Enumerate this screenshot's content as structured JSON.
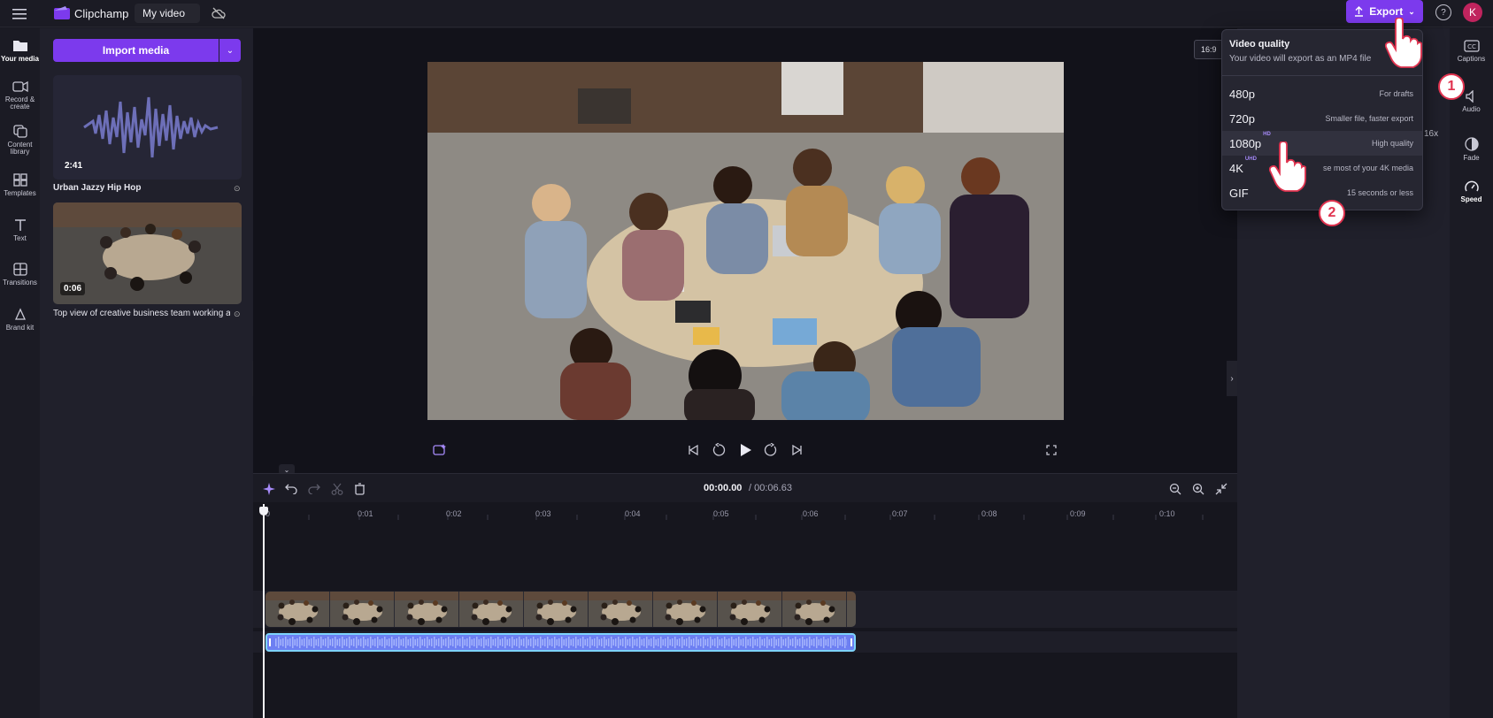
{
  "app": {
    "name": "Clipchamp",
    "project_title": "My video",
    "avatar_initial": "K"
  },
  "topbar": {
    "export_label": "Export"
  },
  "left_rail": [
    {
      "label": "Your media",
      "icon": "folder-icon"
    },
    {
      "label": "Record & create",
      "icon": "camera-icon"
    },
    {
      "label": "Content library",
      "icon": "library-icon"
    },
    {
      "label": "Templates",
      "icon": "templates-icon"
    },
    {
      "label": "Text",
      "icon": "text-icon"
    },
    {
      "label": "Transitions",
      "icon": "transitions-icon"
    },
    {
      "label": "Brand kit",
      "icon": "brand-kit-icon"
    }
  ],
  "media_panel": {
    "import_label": "Import media",
    "items": [
      {
        "title": "Urban Jazzy Hip Hop",
        "duration": "2:41"
      },
      {
        "title": "Top view of creative business team working at ...",
        "duration": "0:06"
      }
    ]
  },
  "stage": {
    "aspect_ratio": "16:9",
    "speed_partial": "16x"
  },
  "right_rail": [
    {
      "label": "Captions",
      "icon": "captions-icon"
    },
    {
      "label": "Audio",
      "icon": "audio-icon"
    },
    {
      "label": "Fade",
      "icon": "fade-icon"
    },
    {
      "label": "Speed",
      "icon": "speed-icon"
    }
  ],
  "export_menu": {
    "title": "Video quality",
    "subtitle": "Your video will export as an MP4 file",
    "options": [
      {
        "label": "480p",
        "badge": "",
        "desc": "For drafts"
      },
      {
        "label": "720p",
        "badge": "",
        "desc": "Smaller file, faster export"
      },
      {
        "label": "1080p",
        "badge": "HD",
        "desc": "High quality"
      },
      {
        "label": "4K",
        "badge": "UHD",
        "desc": "se most of your 4K media"
      },
      {
        "label": "GIF",
        "badge": "",
        "desc": "15 seconds or less"
      }
    ]
  },
  "timeline": {
    "current_time": "00:00.00",
    "total_time": "/ 00:06.63",
    "ticks": [
      "0",
      "0:01",
      "0:02",
      "0:03",
      "0:04",
      "0:05",
      "0:06",
      "0:07",
      "0:08",
      "0:09",
      "0:10"
    ]
  },
  "callouts": [
    "1",
    "2"
  ],
  "colors": {
    "accent": "#7c3aed",
    "audio_clip": "#6d7ff2",
    "callout": "#e0334f"
  }
}
